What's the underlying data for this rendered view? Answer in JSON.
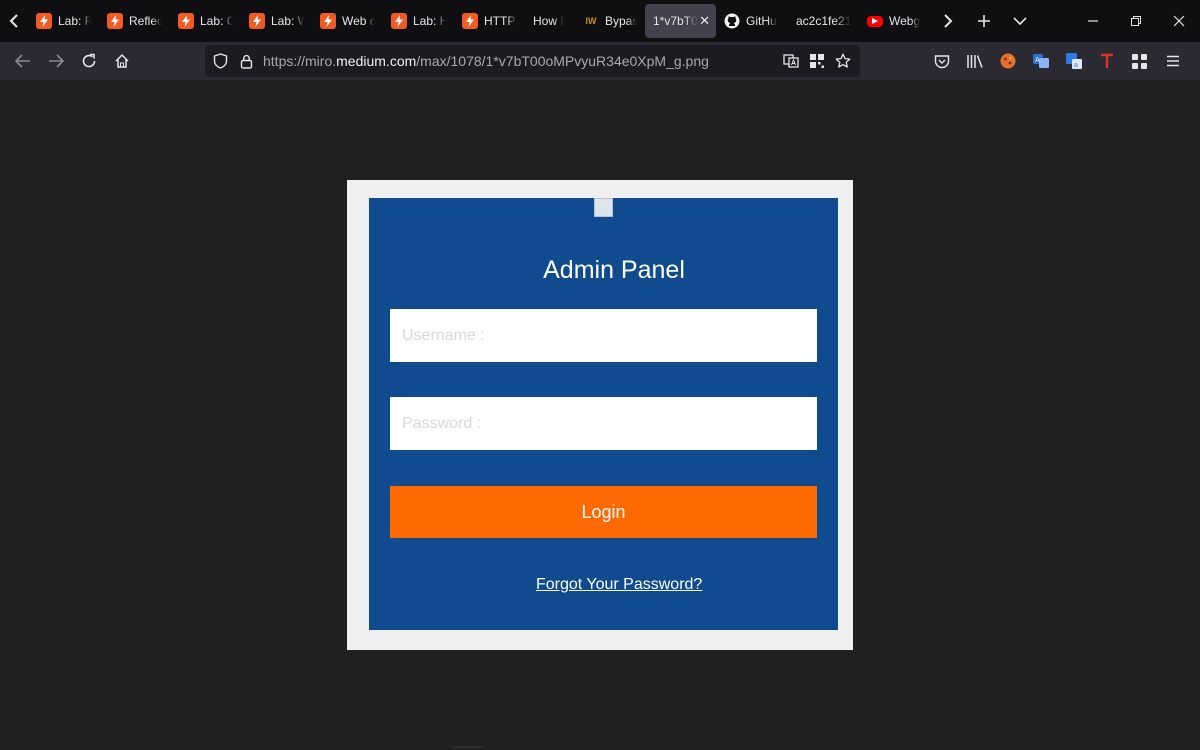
{
  "browser": {
    "tabs": [
      {
        "label": "Lab: R",
        "favicon": "bolt-icon",
        "active": false
      },
      {
        "label": "Reflec",
        "favicon": "bolt-icon",
        "active": false
      },
      {
        "label": "Lab: C",
        "favicon": "bolt-icon",
        "active": false
      },
      {
        "label": "Lab: W",
        "favicon": "bolt-icon",
        "active": false
      },
      {
        "label": "Web c",
        "favicon": "bolt-icon",
        "active": false
      },
      {
        "label": "Lab: H",
        "favicon": "bolt-icon",
        "active": false
      },
      {
        "label": "HTTP/",
        "favicon": "bolt-icon",
        "active": false
      },
      {
        "label": "How I",
        "favicon": "none",
        "active": false
      },
      {
        "label": "Bypas",
        "favicon": "iw-icon",
        "active": false
      },
      {
        "label": "1*v7bT0",
        "favicon": "none",
        "active": true
      },
      {
        "label": "GitHu",
        "favicon": "github-icon",
        "active": false
      },
      {
        "label": "ac2c1fe21",
        "favicon": "none",
        "active": false
      },
      {
        "label": "Webg",
        "favicon": "youtube-icon",
        "active": false
      }
    ],
    "iw_badge": "IW",
    "url": {
      "prefix": "https://miro.",
      "host": "medium.com",
      "path": "/max/1078/1*v7bT00oMPvyuR34e0XpM_g.png"
    },
    "colors": {
      "orange": "#ff6a00",
      "panel_blue": "#0f4b8e",
      "bolt": "#f15a22"
    }
  },
  "page": {
    "title": "Admin Panel",
    "username_placeholder": "Username :",
    "password_placeholder": "Password :",
    "login_label": "Login",
    "forgot_label": "Forgot Your Password?"
  }
}
